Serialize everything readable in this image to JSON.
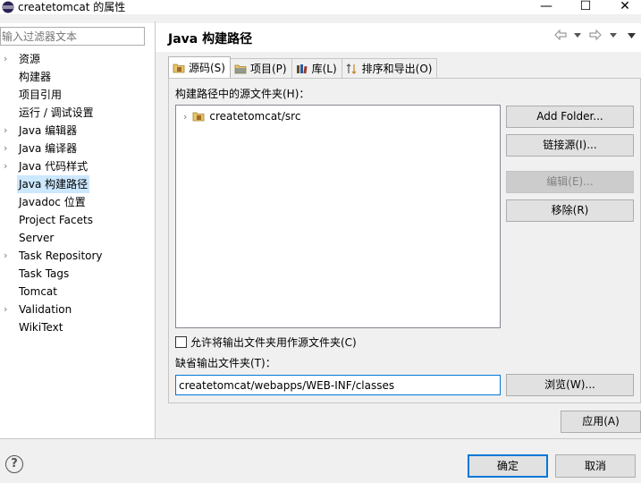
{
  "window": {
    "title": "createtomcat 的属性",
    "minimize_glyph": "—",
    "maximize_glyph": "☐",
    "close_glyph": "✕"
  },
  "filter": {
    "placeholder": "输入过滤器文本"
  },
  "tree": {
    "items": [
      {
        "label": "资源",
        "expandable": true,
        "selected": false
      },
      {
        "label": "构建器",
        "expandable": false,
        "selected": false
      },
      {
        "label": "项目引用",
        "expandable": false,
        "selected": false
      },
      {
        "label": "运行 / 调试设置",
        "expandable": false,
        "selected": false
      },
      {
        "label": "Java 编辑器",
        "expandable": true,
        "selected": false
      },
      {
        "label": "Java 编译器",
        "expandable": true,
        "selected": false
      },
      {
        "label": "Java 代码样式",
        "expandable": true,
        "selected": false
      },
      {
        "label": "Java 构建路径",
        "expandable": false,
        "selected": true
      },
      {
        "label": "Javadoc 位置",
        "expandable": false,
        "selected": false
      },
      {
        "label": "Project Facets",
        "expandable": false,
        "selected": false
      },
      {
        "label": "Server",
        "expandable": false,
        "selected": false
      },
      {
        "label": "Task Repository",
        "expandable": true,
        "selected": false
      },
      {
        "label": "Task Tags",
        "expandable": false,
        "selected": false
      },
      {
        "label": "Tomcat",
        "expandable": false,
        "selected": false
      },
      {
        "label": "Validation",
        "expandable": true,
        "selected": false
      },
      {
        "label": "WikiText",
        "expandable": false,
        "selected": false
      }
    ]
  },
  "section": {
    "title": "Java 构建路径"
  },
  "tabs": [
    {
      "label": "源码(S)",
      "icon": "source-folder-icon",
      "active": true
    },
    {
      "label": "项目(P)",
      "icon": "project-icon",
      "active": false
    },
    {
      "label": "库(L)",
      "icon": "library-icon",
      "active": false
    },
    {
      "label": "排序和导出(O)",
      "icon": "order-export-icon",
      "active": false
    }
  ],
  "source_tab": {
    "list_label": "构建路径中的源文件夹(H)：",
    "folders": [
      "createtomcat/src"
    ],
    "buttons": {
      "add_folder": "Add Folder...",
      "link_source": "链接源(I)...",
      "edit": "编辑(E)...",
      "remove": "移除(R)"
    },
    "allow_output_label": "允许将输出文件夹用作源文件夹(C)",
    "allow_output_checked": false,
    "output_label": "缺省输出文件夹(T)：",
    "output_value": "createtomcat/webapps/WEB-INF/classes",
    "browse": "浏览(W)..."
  },
  "apply_label": "应用(A)",
  "help_glyph": "?",
  "footer": {
    "ok_label": "确定",
    "cancel_label": "取消"
  },
  "colors": {
    "selection": "#cce8ff",
    "focus_border": "#0078d7"
  }
}
